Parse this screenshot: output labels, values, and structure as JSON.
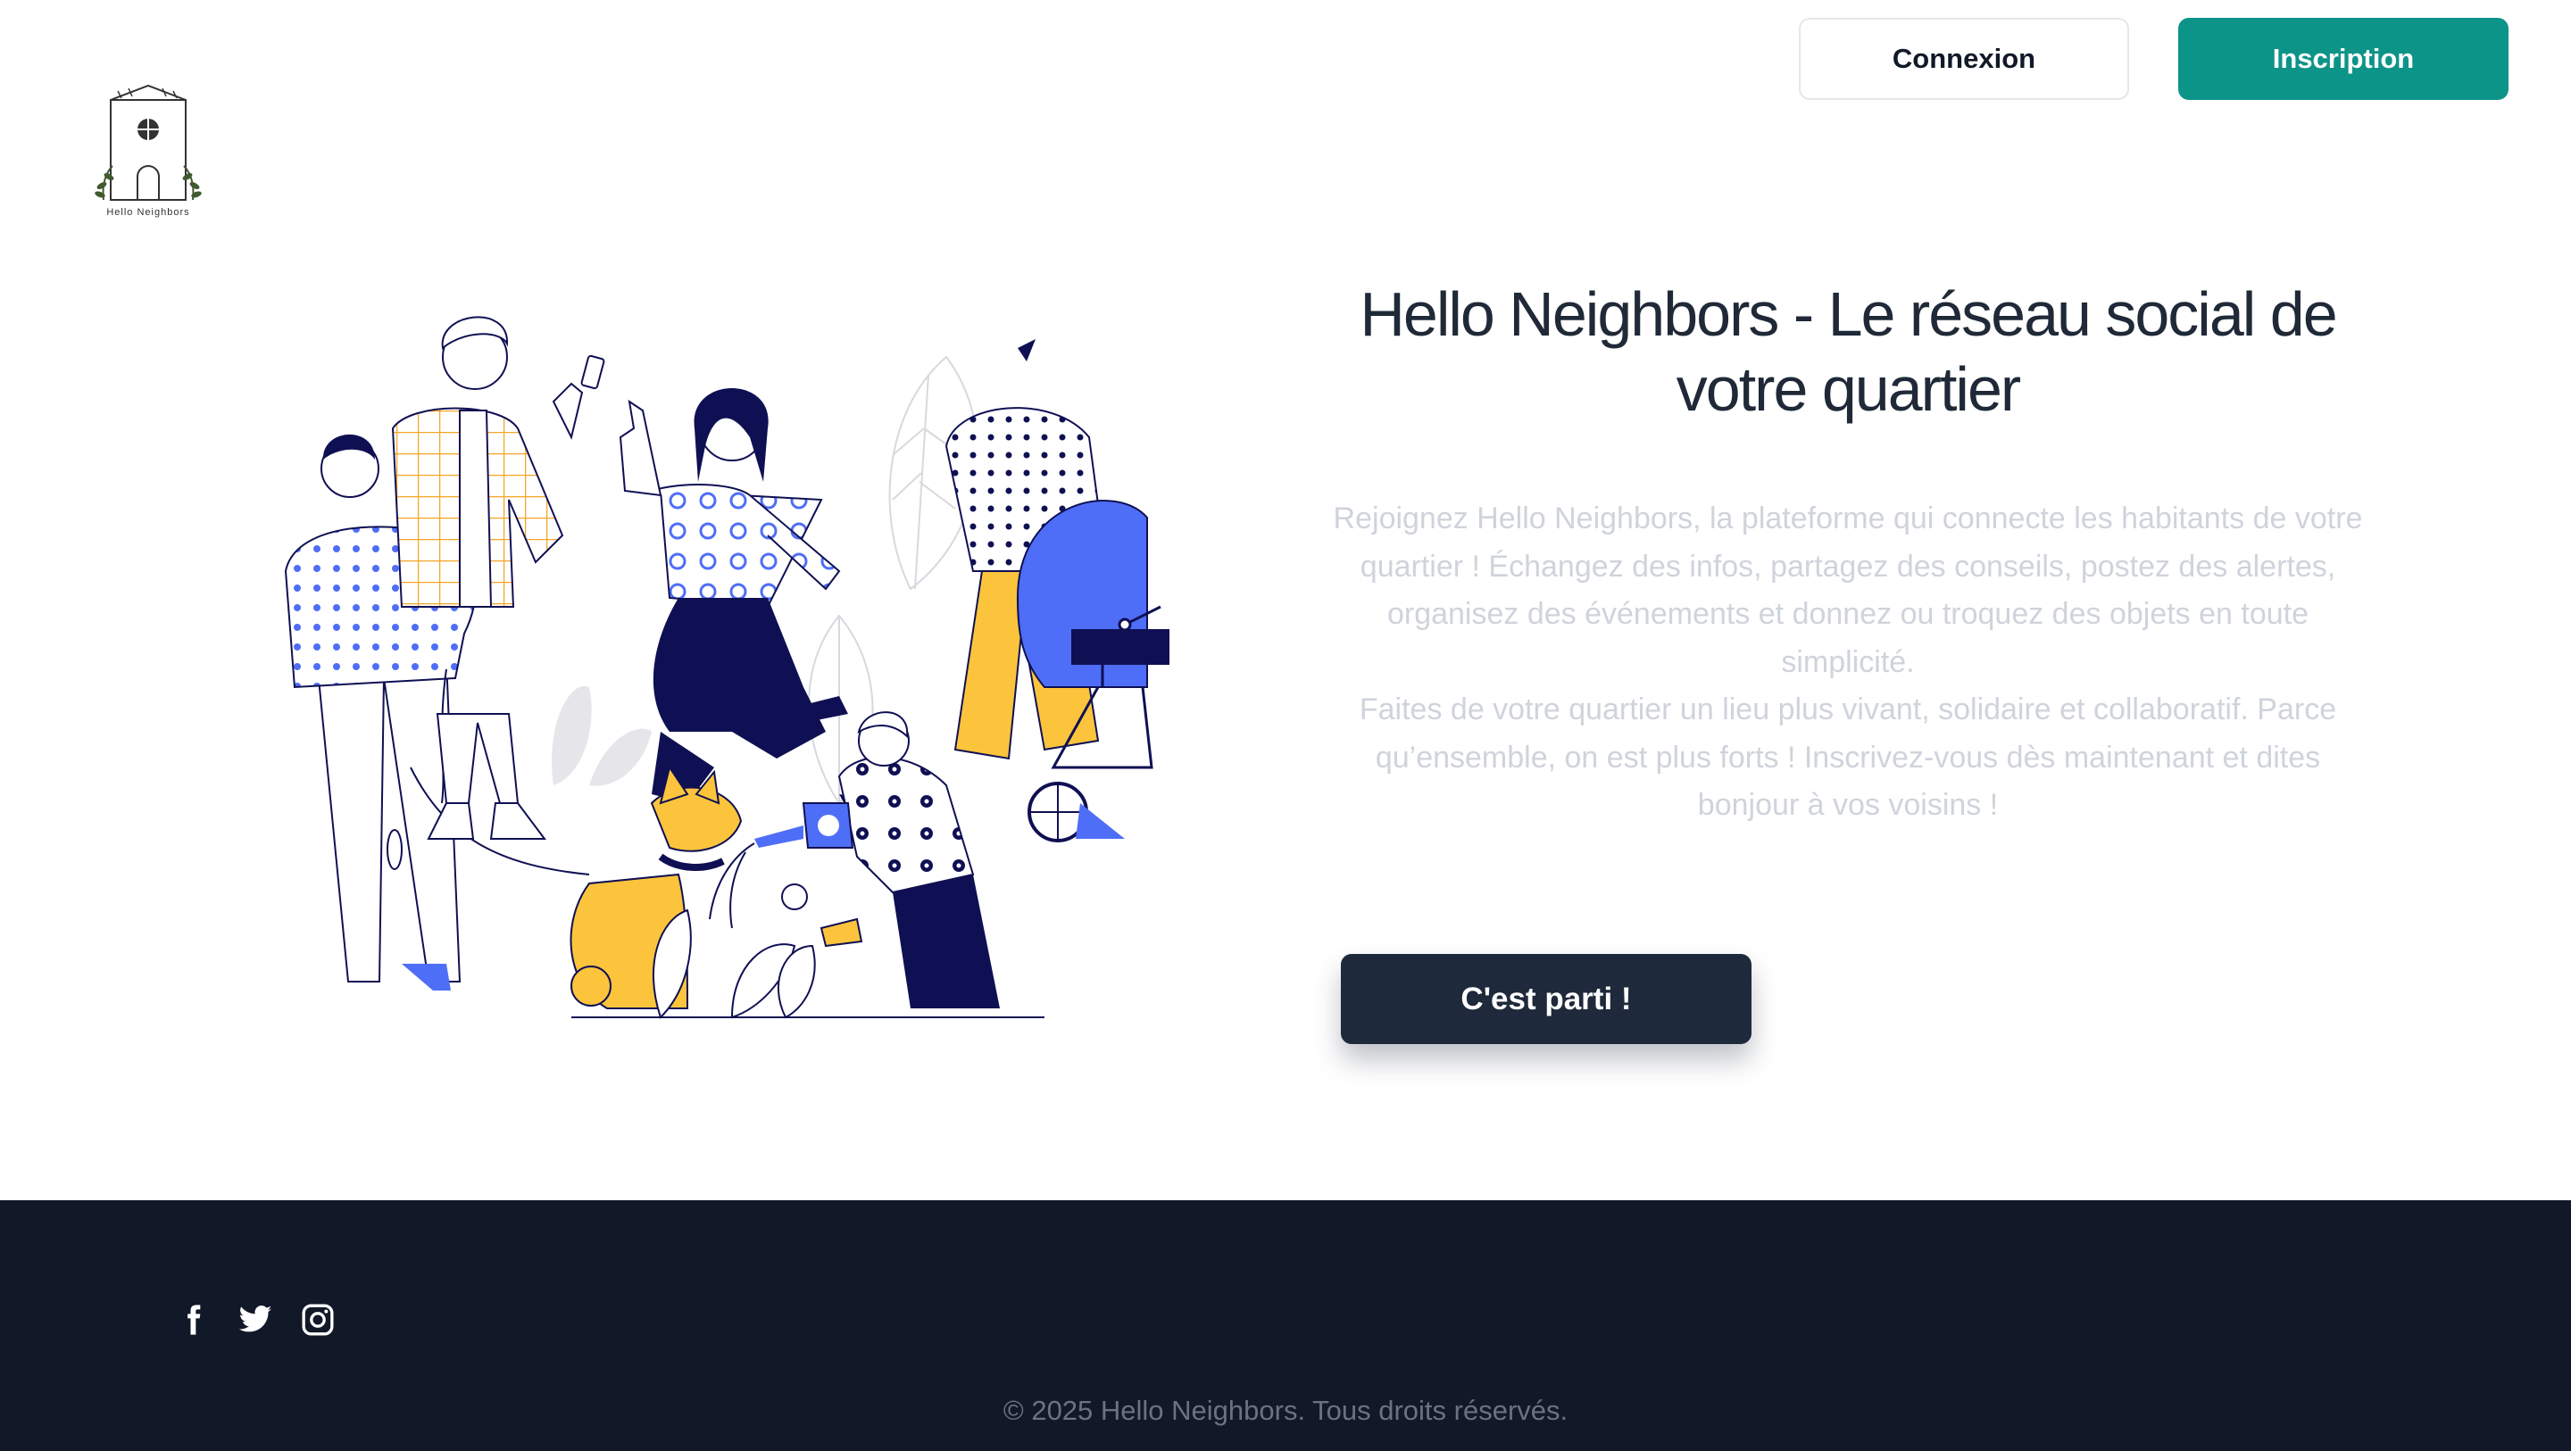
{
  "header": {
    "logo_text": "Hello Neighbors",
    "login_label": "Connexion",
    "signup_label": "Inscription"
  },
  "hero": {
    "title": "Hello Neighbors - Le réseau social de votre quartier",
    "paragraphs": [
      "Rejoignez Hello Neighbors, la plateforme qui connecte les habitants de votre quartier ! Échangez des infos, partagez des conseils, postez des alertes, organisez des événements et donnez ou troquez des objets en toute simplicité.",
      "Faites de votre quartier un lieu plus vivant, solidaire et collaboratif. Parce qu’ensemble, on est plus forts ! Inscrivez-vous dès maintenant et dites bonjour à vos voisins !"
    ],
    "cta_label": "C'est parti !"
  },
  "footer": {
    "socials": [
      "facebook-icon",
      "twitter-icon",
      "instagram-icon"
    ],
    "copyright": "© 2025 Hello Neighbors. Tous droits réservés."
  },
  "colors": {
    "accent": "#0d9488",
    "cta_bg": "#1e293b",
    "footer_bg": "#111827",
    "illustration_blue": "#4f6ef7",
    "illustration_yellow": "#fbc43c",
    "illustration_navy": "#0f1053"
  }
}
